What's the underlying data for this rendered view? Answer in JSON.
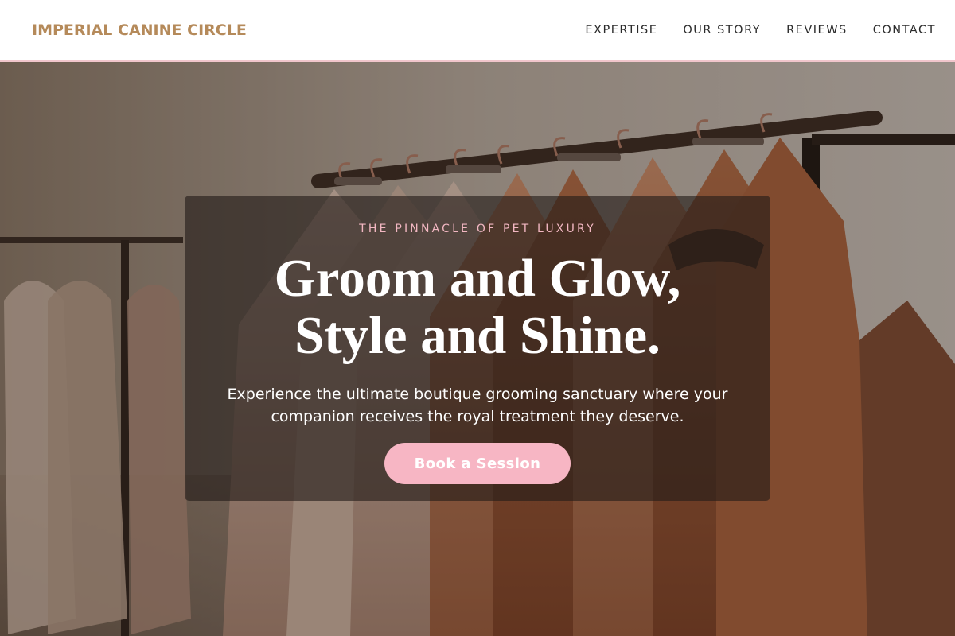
{
  "brand": {
    "name": "IMPERIAL CANINE CIRCLE",
    "color": "#b58a5a"
  },
  "nav": {
    "items": [
      {
        "label": "EXPERTISE"
      },
      {
        "label": "OUR STORY"
      },
      {
        "label": "REVIEWS"
      },
      {
        "label": "CONTACT"
      }
    ]
  },
  "hero": {
    "background_image": "clothing-rack-with-hangers-photo",
    "eyebrow": "THE PINNACLE OF PET LUXURY",
    "headline_line1": "Groom and Glow,",
    "headline_line2": "Style and Shine.",
    "subtext": "Experience the ultimate boutique grooming sanctuary where your companion receives the royal treatment they deserve.",
    "cta_label": "Book a Session"
  },
  "colors": {
    "accent_pink": "#f7b6c4",
    "eyebrow_pink": "#f2b7c2",
    "header_border": "#f1c6cc"
  }
}
